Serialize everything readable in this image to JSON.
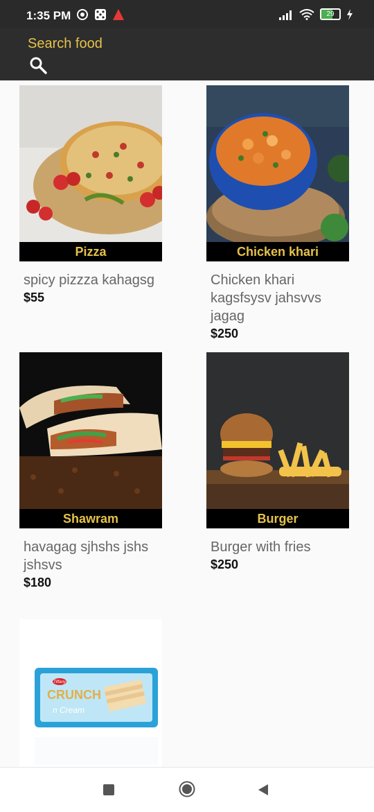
{
  "status_bar": {
    "time": "1:35 PM",
    "battery": "29"
  },
  "header": {
    "search_label": "Search food"
  },
  "items": [
    {
      "name": "Pizza",
      "description": "spicy pizzza kahagsg",
      "price": "$55"
    },
    {
      "name": "Chicken khari",
      "description": "Chicken khari kagsfsysv jahsvvs jagag",
      "price": "$250"
    },
    {
      "name": "Shawram",
      "description": "havagag sjhshs jshs jshsvs",
      "price": "$180"
    },
    {
      "name": "Burger",
      "description": "Burger with fries",
      "price": "$250"
    },
    {
      "name": "",
      "description": "",
      "price": "",
      "wrapper_text": {
        "brand": "Tiffany",
        "title": "CRUNCH",
        "subtitle": "n Cream"
      }
    }
  ],
  "colors": {
    "accent": "#e6c24a",
    "appbar": "#2d2d2d",
    "tag_bg": "#000000"
  },
  "nav": {
    "icons": [
      "recents-icon",
      "home-icon",
      "back-icon"
    ]
  }
}
